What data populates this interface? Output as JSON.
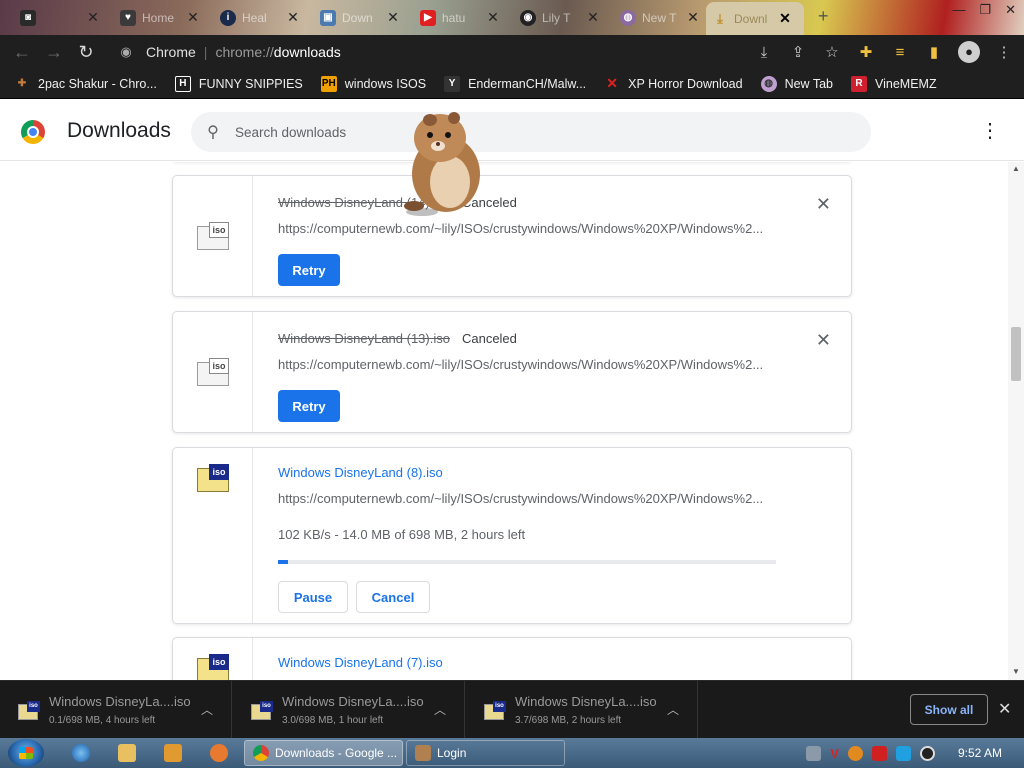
{
  "tabs": [
    {
      "title": "",
      "favicon": "ddd-logo-icon",
      "active": false
    },
    {
      "title": "Home",
      "favicon": "heart-shield-icon",
      "active": false
    },
    {
      "title": "Heal",
      "favicon": "info-circle-icon",
      "active": false
    },
    {
      "title": "Down",
      "favicon": "image-icon",
      "active": false
    },
    {
      "title": "hatu",
      "favicon": "youtube-icon",
      "active": false
    },
    {
      "title": "Lily T",
      "favicon": "github-icon",
      "active": false
    },
    {
      "title": "New T",
      "favicon": "globe-icon",
      "active": false
    },
    {
      "title": "Downl",
      "favicon": "download-icon",
      "active": true
    }
  ],
  "toolbar": {
    "site_label": "Chrome",
    "url_scheme": "chrome://",
    "url_path": "downloads"
  },
  "bookmarks": [
    {
      "label": "2pac Shakur - Chro...",
      "icon": "puzzle-piece-icon",
      "color": "#c07a3a"
    },
    {
      "label": "FUNNY SNIPPIES",
      "icon": "h-logo-icon",
      "color": "#ffffff"
    },
    {
      "label": "windows ISOS",
      "icon": "ph-logo-icon",
      "color": "#f0a000"
    },
    {
      "label": "EndermanCH/Malw...",
      "icon": "yp-logo-icon",
      "color": "#2a2a2a"
    },
    {
      "label": "XP Horror Download",
      "icon": "x-icon",
      "color": "#e02020"
    },
    {
      "label": "New Tab",
      "icon": "globe-icon",
      "color": "#c0a0d0"
    },
    {
      "label": "VineMEMZ",
      "icon": "r-logo-icon",
      "color": "#d02030"
    }
  ],
  "header": {
    "title": "Downloads",
    "search_placeholder": "Search downloads"
  },
  "downloads": [
    {
      "filename": "Windows DisneyLand (14).iso",
      "status": "Canceled",
      "url": "https://computernewb.com/~lily/ISOs/crustywindows/Windows%20XP/Windows%2...",
      "action": "Retry"
    },
    {
      "filename": "Windows DisneyLand (13).iso",
      "status": "Canceled",
      "url": "https://computernewb.com/~lily/ISOs/crustywindows/Windows%20XP/Windows%2...",
      "action": "Retry"
    },
    {
      "filename": "Windows DisneyLand (8).iso",
      "url": "https://computernewb.com/~lily/ISOs/crustywindows/Windows%20XP/Windows%2...",
      "progress_text": "102 KB/s - 14.0 MB of 698 MB, 2 hours left",
      "progress_fraction": 0.02,
      "pause_label": "Pause",
      "cancel_label": "Cancel"
    },
    {
      "filename": "Windows DisneyLand (7).iso"
    }
  ],
  "shelf": {
    "items": [
      {
        "name": "Windows DisneyLa....iso",
        "progress": "0.1/698 MB, 4 hours left"
      },
      {
        "name": "Windows DisneyLa....iso",
        "progress": "3.0/698 MB, 1 hour left"
      },
      {
        "name": "Windows DisneyLa....iso",
        "progress": "3.7/698 MB, 2 hours left"
      }
    ],
    "show_all": "Show all"
  },
  "taskbar": {
    "buttons": [
      {
        "label": "Downloads - Google ...",
        "active": true
      },
      {
        "label": "Login",
        "active": false
      }
    ],
    "clock": "9:52 AM"
  },
  "colors": {
    "accent": "#1a73e8",
    "link": "#1a73e8",
    "toolbar_bg": "#1f1f1f",
    "shelf_bg": "#1a1a1a"
  }
}
